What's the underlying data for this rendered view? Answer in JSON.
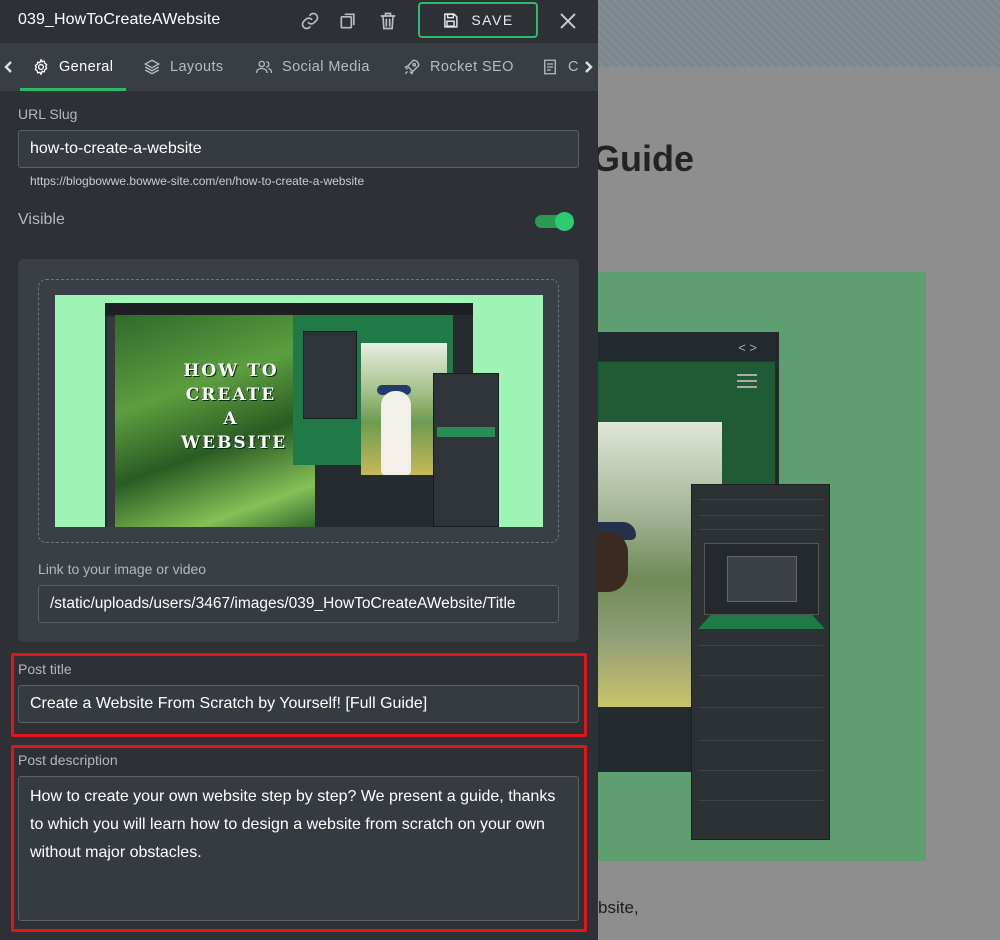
{
  "header": {
    "title": "039_HowToCreateAWebsite",
    "save_label": "SAVE"
  },
  "tabs": [
    {
      "label": "General",
      "icon": "gear-icon",
      "active": true
    },
    {
      "label": "Layouts",
      "icon": "layers-icon"
    },
    {
      "label": "Social Media",
      "icon": "users-icon"
    },
    {
      "label": "Rocket SEO",
      "icon": "rocket-icon"
    },
    {
      "label": "C",
      "icon": "document-icon"
    }
  ],
  "slug": {
    "label": "URL Slug",
    "value": "how-to-create-a-website",
    "full_url": "https://blogbowwe.bowwe-site.com/en/how-to-create-a-website"
  },
  "visible": {
    "label": "Visible",
    "on": true
  },
  "media": {
    "thumbnail_text": "HOW TO CREATE A WEBSITE",
    "link_label": "Link to your image or video",
    "link_value": "/static/uploads/users/3467/images/039_HowToCreateAWebsite/Title"
  },
  "post_title": {
    "label": "Post title",
    "value": "Create a Website From Scratch by Yourself! [Full Guide]"
  },
  "post_description": {
    "label": "Post description",
    "value": "How to create your own website step by step? We present a guide, thanks to which you will learn how to design a website from scratch on your own without major obstacles."
  },
  "background_page": {
    "heading_fragment": "Guide",
    "text_fragment": "bsite,"
  },
  "colors": {
    "accent": "#2dbb6a",
    "panel_bg": "#2d3136",
    "highlight": "#e0151a"
  }
}
